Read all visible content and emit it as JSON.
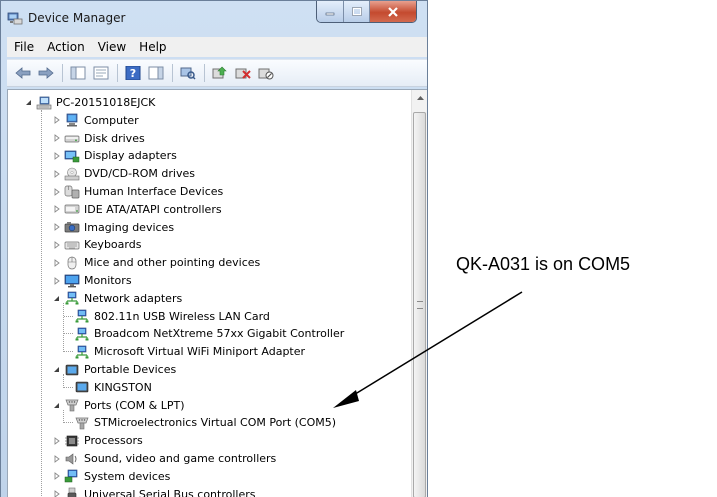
{
  "window": {
    "title": "Device Manager"
  },
  "menubar": {
    "items": [
      "File",
      "Action",
      "View",
      "Help"
    ]
  },
  "toolbar": {
    "icons": [
      "back-arrow-icon",
      "forward-arrow-icon",
      "show-hide-tree-icon",
      "properties-icon",
      "help-icon",
      "action-pane-icon",
      "scan-hardware-icon",
      "update-driver-icon",
      "uninstall-icon",
      "disable-device-icon"
    ]
  },
  "tree": {
    "root": "PC-20151018EJCK",
    "nodes": [
      {
        "label": "Computer",
        "state": "collapsed",
        "depth": 1,
        "icon": "computer-icon"
      },
      {
        "label": "Disk drives",
        "state": "collapsed",
        "depth": 1,
        "icon": "disk-drive-icon"
      },
      {
        "label": "Display adapters",
        "state": "collapsed",
        "depth": 1,
        "icon": "display-adapter-icon"
      },
      {
        "label": "DVD/CD-ROM drives",
        "state": "collapsed",
        "depth": 1,
        "icon": "dvd-drive-icon"
      },
      {
        "label": "Human Interface Devices",
        "state": "collapsed",
        "depth": 1,
        "icon": "hid-icon"
      },
      {
        "label": "IDE ATA/ATAPI controllers",
        "state": "collapsed",
        "depth": 1,
        "icon": "ide-controller-icon"
      },
      {
        "label": "Imaging devices",
        "state": "collapsed",
        "depth": 1,
        "icon": "camera-icon"
      },
      {
        "label": "Keyboards",
        "state": "collapsed",
        "depth": 1,
        "icon": "keyboard-icon"
      },
      {
        "label": "Mice and other pointing devices",
        "state": "collapsed",
        "depth": 1,
        "icon": "mouse-icon"
      },
      {
        "label": "Monitors",
        "state": "collapsed",
        "depth": 1,
        "icon": "monitor-icon"
      },
      {
        "label": "Network adapters",
        "state": "expanded",
        "depth": 1,
        "icon": "network-adapter-icon"
      },
      {
        "label": "802.11n USB Wireless LAN Card",
        "state": "leaf",
        "depth": 2,
        "icon": "network-adapter-icon"
      },
      {
        "label": "Broadcom NetXtreme 57xx Gigabit Controller",
        "state": "leaf",
        "depth": 2,
        "icon": "network-adapter-icon"
      },
      {
        "label": "Microsoft Virtual WiFi Miniport Adapter",
        "state": "leaf",
        "depth": 2,
        "icon": "network-adapter-icon"
      },
      {
        "label": "Portable Devices",
        "state": "expanded",
        "depth": 1,
        "icon": "portable-device-icon"
      },
      {
        "label": "KINGSTON",
        "state": "leaf",
        "depth": 2,
        "icon": "portable-device-icon"
      },
      {
        "label": "Ports (COM & LPT)",
        "state": "expanded",
        "depth": 1,
        "icon": "port-icon"
      },
      {
        "label": "STMicroelectronics Virtual COM Port (COM5)",
        "state": "leaf",
        "depth": 2,
        "icon": "port-icon"
      },
      {
        "label": "Processors",
        "state": "collapsed",
        "depth": 1,
        "icon": "processor-icon"
      },
      {
        "label": "Sound, video and game controllers",
        "state": "collapsed",
        "depth": 1,
        "icon": "sound-icon"
      },
      {
        "label": "System devices",
        "state": "collapsed",
        "depth": 1,
        "icon": "system-device-icon"
      },
      {
        "label": "Universal Serial Bus controllers",
        "state": "collapsed",
        "depth": 1,
        "icon": "usb-controller-icon"
      }
    ]
  },
  "annotation": {
    "text": "QK-A031 is on COM5"
  }
}
